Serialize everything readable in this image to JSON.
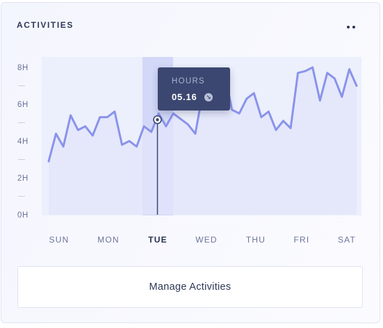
{
  "card": {
    "title": "ACTIVITIES",
    "more_icon": "more-horizontal-dots-icon"
  },
  "tooltip": {
    "label": "HOURS",
    "value": "05.16",
    "icon": "arrow-down-right-circle-icon"
  },
  "button": {
    "label": "Manage Activities"
  },
  "colors": {
    "line": "#8a93ea",
    "area": "#e3e6fb",
    "highlight": "#d3d8f8",
    "tooltip_bg": "#3b4770",
    "text": "#2d3758",
    "muted": "#6b7499"
  },
  "chart_data": {
    "type": "area",
    "title": "",
    "xlabel": "",
    "ylabel": "",
    "ylim": [
      0,
      8
    ],
    "y_ticks": [
      "0H",
      "2H",
      "4H",
      "6H",
      "8H"
    ],
    "categories": [
      "SUN",
      "MON",
      "TUE",
      "WED",
      "THU",
      "FRI",
      "SAT"
    ],
    "active_category": "TUE",
    "highlight_value": 5.16,
    "series": [
      {
        "values": [
          2.9,
          4.4,
          3.7,
          5.4,
          4.6,
          4.8,
          4.3,
          5.3,
          5.3,
          5.6,
          3.8,
          4.0,
          3.7,
          4.8,
          4.5,
          5.5,
          4.8,
          5.5,
          5.2,
          4.9,
          4.4,
          6.6,
          6.6,
          6.8,
          7.7,
          5.7,
          5.5,
          6.3,
          6.6,
          5.3,
          5.6,
          4.6,
          5.1,
          4.7,
          7.7,
          7.8,
          8.0,
          6.2,
          7.7,
          7.4,
          6.4,
          7.9,
          7.0
        ]
      }
    ]
  }
}
